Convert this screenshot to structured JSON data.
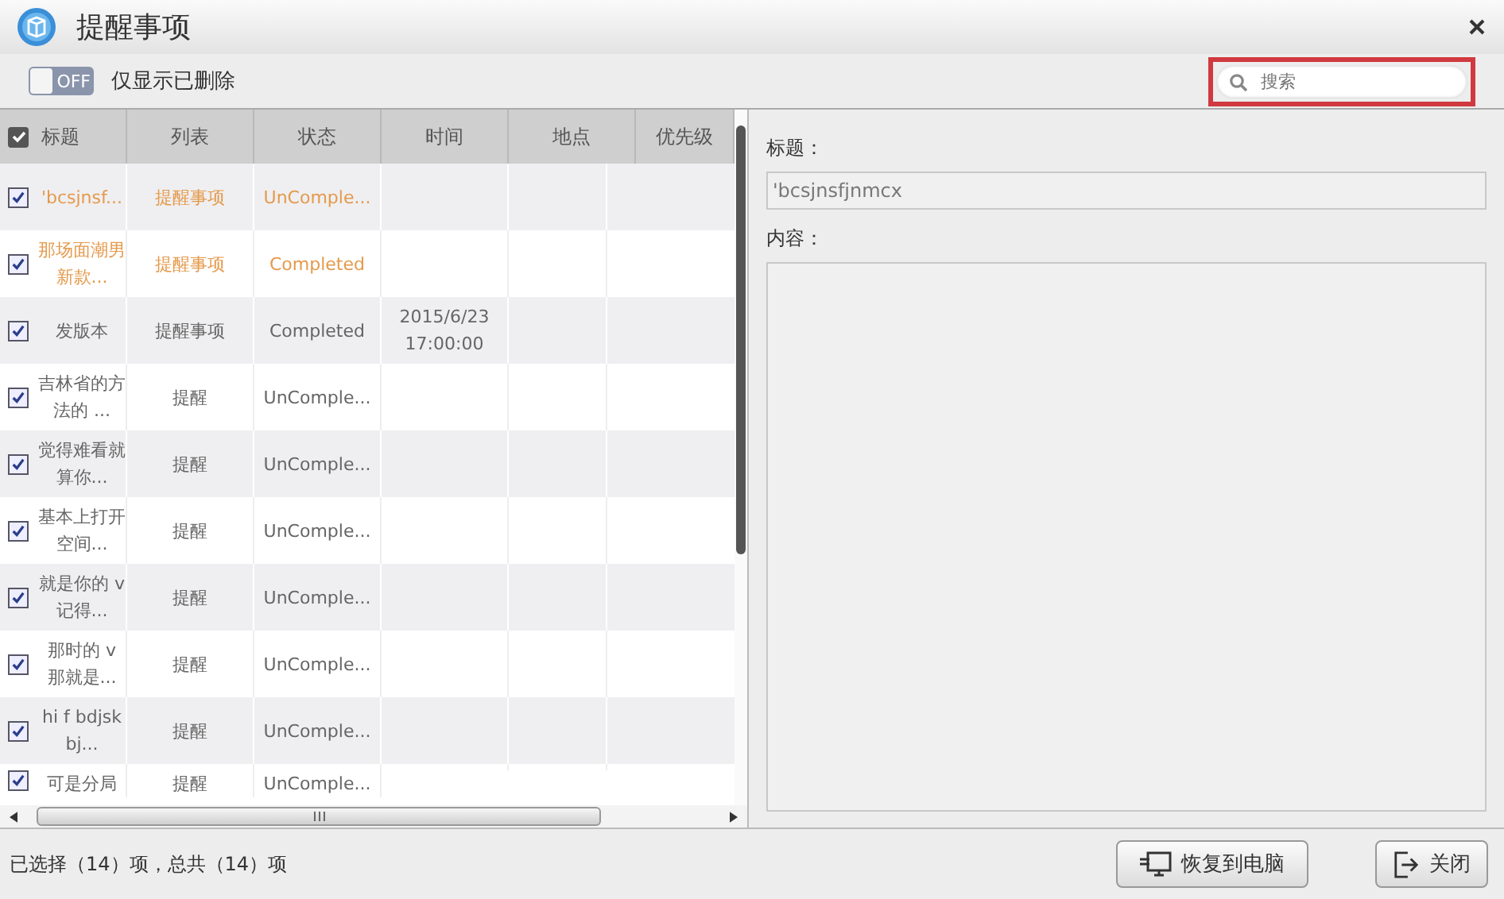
{
  "window": {
    "title": "提醒事项"
  },
  "toolbar": {
    "toggle": {
      "label": "OFF",
      "on": false
    },
    "toggle_label": "仅显示已删除",
    "search": {
      "placeholder": "搜索"
    }
  },
  "table": {
    "all_checked": true,
    "columns": [
      "标题",
      "列表",
      "状态",
      "时间",
      "地点",
      "优先级"
    ],
    "rows": [
      {
        "checked": true,
        "highlighted": true,
        "cells": [
          "'bcsjnsf...",
          "提醒事项",
          "UnComple...",
          "",
          ""
        ]
      },
      {
        "checked": true,
        "highlighted": true,
        "cells": [
          "那场面潮男新款...",
          "提醒事项",
          "Completed",
          "",
          ""
        ]
      },
      {
        "checked": true,
        "highlighted": false,
        "cells": [
          "发版本",
          "提醒事项",
          "Completed",
          "2015/6/23 17:00:00",
          ""
        ]
      },
      {
        "checked": true,
        "highlighted": false,
        "cells": [
          "吉林省的方法的 ...",
          "提醒",
          "UnComple...",
          "",
          ""
        ]
      },
      {
        "checked": true,
        "highlighted": false,
        "cells": [
          "觉得难看就算你...",
          "提醒",
          "UnComple...",
          "",
          ""
        ]
      },
      {
        "checked": true,
        "highlighted": false,
        "cells": [
          "基本上打开空间...",
          "提醒",
          "UnComple...",
          "",
          ""
        ]
      },
      {
        "checked": true,
        "highlighted": false,
        "cells": [
          "就是你的 v 记得...",
          "提醒",
          "UnComple...",
          "",
          ""
        ]
      },
      {
        "checked": true,
        "highlighted": false,
        "cells": [
          "那时的 v 那就是...",
          "提醒",
          "UnComple...",
          "",
          ""
        ]
      },
      {
        "checked": true,
        "highlighted": false,
        "cells": [
          "hi f bdjskbj...",
          "提醒",
          "UnComple...",
          "",
          ""
        ]
      },
      {
        "checked": true,
        "highlighted": false,
        "cells": [
          "可是分局",
          "提醒",
          "UnComple...",
          "",
          ""
        ]
      }
    ]
  },
  "detail": {
    "title_label": "标题：",
    "title_value": "'bcsjnsfjnmcx",
    "content_label": "内容："
  },
  "status_bar": {
    "text": "已选择（14）项，总共（14）项",
    "buttons": [
      {
        "kind": "restore",
        "label": "恢复到电脑"
      },
      {
        "kind": "close",
        "label": "关闭"
      }
    ]
  }
}
